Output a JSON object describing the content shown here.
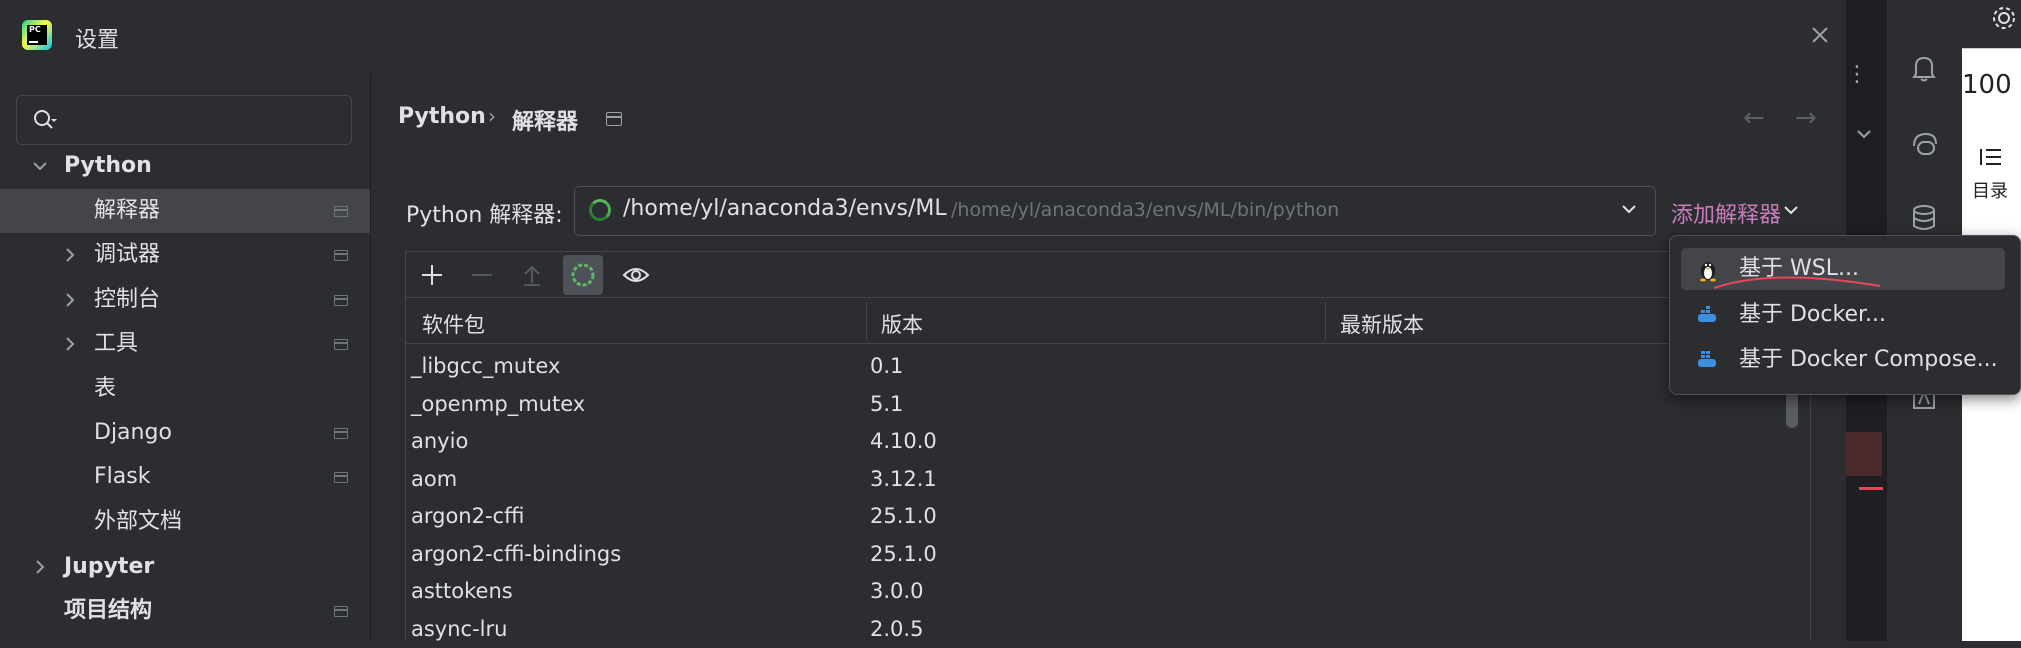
{
  "dialog": {
    "title": "设置",
    "app_icon_text": "PC"
  },
  "sidebar": {
    "search": {
      "placeholder": ""
    },
    "items": [
      {
        "label": "Python",
        "level": 0,
        "expanded": true,
        "bold": true
      },
      {
        "label": "解释器",
        "level": 1,
        "selected": true,
        "pinned": true
      },
      {
        "label": "调试器",
        "level": 1,
        "expandable": true,
        "pinned": true
      },
      {
        "label": "控制台",
        "level": 1,
        "expandable": true,
        "pinned": true
      },
      {
        "label": "工具",
        "level": 1,
        "expandable": true,
        "pinned": true
      },
      {
        "label": "表",
        "level": 1
      },
      {
        "label": "Django",
        "level": 1,
        "pinned": true
      },
      {
        "label": "Flask",
        "level": 1,
        "pinned": true
      },
      {
        "label": "外部文档",
        "level": 1
      },
      {
        "label": "Jupyter",
        "level": 0,
        "expandable": true,
        "bold": true
      },
      {
        "label": "项目结构",
        "level": 0,
        "bold": true,
        "pinned": true
      }
    ]
  },
  "breadcrumb": {
    "root": "Python",
    "separator": "›",
    "current": "解释器"
  },
  "interpreter": {
    "label": "Python 解释器:",
    "name": "/home/yl/anaconda3/envs/ML",
    "path": "/home/yl/anaconda3/envs/ML/bin/python",
    "add_label": "添加解释器"
  },
  "packages": {
    "headers": [
      "软件包",
      "版本",
      "最新版本"
    ],
    "rows": [
      {
        "name": "_libgcc_mutex",
        "version": "0.1"
      },
      {
        "name": "_openmp_mutex",
        "version": "5.1"
      },
      {
        "name": "anyio",
        "version": "4.10.0"
      },
      {
        "name": "aom",
        "version": "3.12.1"
      },
      {
        "name": "argon2-cffi",
        "version": "25.1.0"
      },
      {
        "name": "argon2-cffi-bindings",
        "version": "25.1.0"
      },
      {
        "name": "asttokens",
        "version": "3.0.0"
      },
      {
        "name": "async-lru",
        "version": "2.0.5"
      }
    ]
  },
  "popup": {
    "items": [
      {
        "label": "基于 WSL...",
        "icon": "linux-tux-icon",
        "highlighted": true
      },
      {
        "label": "基于 Docker...",
        "icon": "docker-icon"
      },
      {
        "label": "基于 Docker Compose...",
        "icon": "docker-compose-icon"
      }
    ]
  },
  "browser": {
    "zoom": "100",
    "toc_label": "目录"
  },
  "colors": {
    "accent_link": "#c77dbb",
    "selection": "#43454a",
    "background": "#2b2d30",
    "spinner": "#5fb865",
    "annotation_red": "#e5485a"
  }
}
